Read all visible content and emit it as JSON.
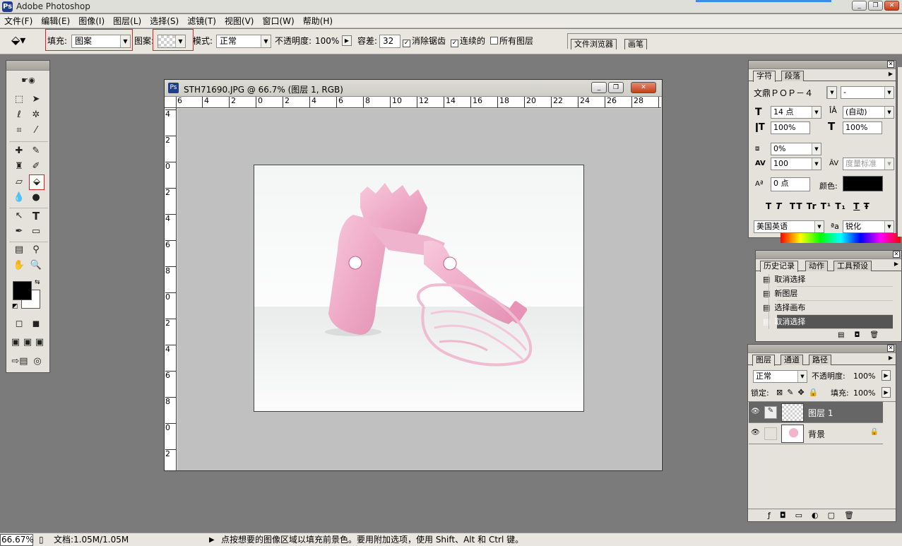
{
  "app": {
    "title": "Adobe Photoshop"
  },
  "menu": [
    "文件(F)",
    "编辑(E)",
    "图像(I)",
    "图层(L)",
    "选择(S)",
    "滤镜(T)",
    "视图(V)",
    "窗口(W)",
    "帮助(H)"
  ],
  "options": {
    "fill_label": "填充:",
    "fill_value": "图案",
    "pattern_label": "图案:",
    "mode_label": "模式:",
    "mode_value": "正常",
    "opacity_label": "不透明度:",
    "opacity_value": "100%",
    "tolerance_label": "容差:",
    "tolerance_value": "32",
    "antialias_label": "消除锯齿",
    "contiguous_label": "连续的",
    "all_layers_label": "所有图层"
  },
  "well_tabs": [
    "文件浏览器",
    "画笔"
  ],
  "document": {
    "title": "STH71690.JPG @ 66.7% (图层 1, RGB)",
    "ruler_h": [
      "6",
      "4",
      "2",
      "0",
      "2",
      "4",
      "6",
      "8",
      "10",
      "12",
      "14",
      "16",
      "18",
      "20",
      "22",
      "24",
      "26",
      "28",
      "3"
    ],
    "ruler_v": [
      "4",
      "2",
      "0",
      "2",
      "4",
      "6",
      "8",
      "0",
      "2",
      "4",
      "6",
      "8",
      "0",
      "2"
    ]
  },
  "character_panel": {
    "tabs": [
      "字符",
      "段落"
    ],
    "font": "文鼎ＰＯＰ－４",
    "font_style": "-",
    "size": "14 点",
    "leading": "(自动)",
    "vscale": "100%",
    "hscale": "100%",
    "tsume": "0%",
    "tracking": "100",
    "kerning": "度量标准",
    "baseline": "0 点",
    "color_label": "颜色:",
    "style_buttons": [
      "T",
      "T",
      "TT",
      "Tr",
      "T¹",
      "T₁",
      "T",
      "Ŧ"
    ],
    "language": "美国英语",
    "aa_label": "ªa",
    "antialias": "锐化",
    "text_color": "#000000"
  },
  "history_panel": {
    "tabs": [
      "历史记录",
      "动作",
      "工具预设"
    ],
    "items": [
      "取消选择",
      "新图层",
      "选择画布",
      "取消选择"
    ]
  },
  "layers_panel": {
    "tabs": [
      "图层",
      "通道",
      "路径"
    ],
    "blend_mode": "正常",
    "opacity_label": "不透明度:",
    "opacity": "100%",
    "lock_label": "锁定:",
    "fill_label": "填充:",
    "fill": "100%",
    "layers": [
      {
        "name": "图层 1"
      },
      {
        "name": "背景"
      }
    ]
  },
  "status": {
    "zoom": "66.67%",
    "doc": "文档:1.05M/1.05M",
    "hint": "点按想要的图像区域以填充前景色。要用附加选项，使用 Shift、Alt 和 Ctrl 键。"
  },
  "colors": {
    "foreground": "#000000",
    "background": "#ffffff",
    "accent_highlight": "#e02020"
  }
}
